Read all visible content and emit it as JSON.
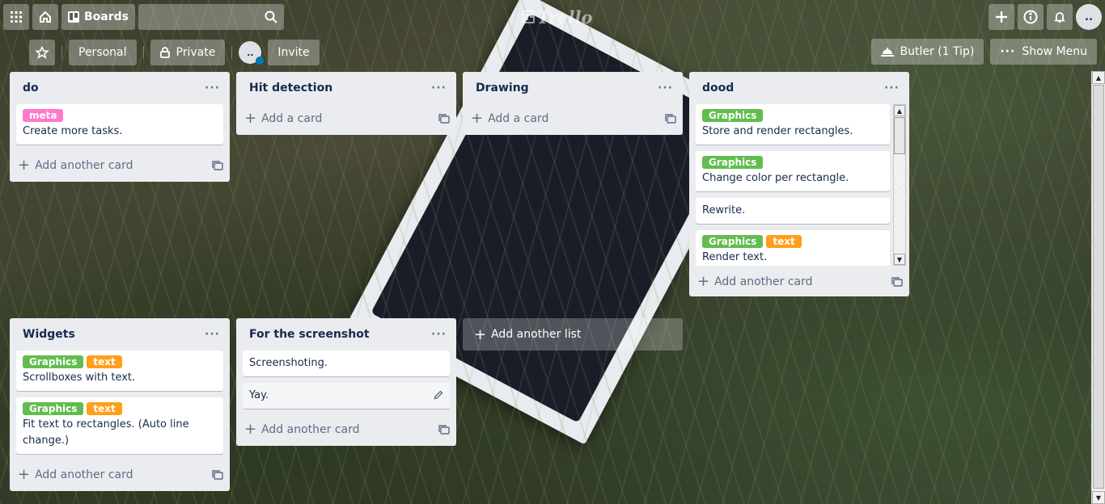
{
  "header": {
    "boards_label": "Boards",
    "logo_text": "Trello",
    "avatar_initials": "..",
    "search_placeholder": ""
  },
  "board": {
    "personal_label": "Personal",
    "private_label": "Private",
    "member_avatar": "..",
    "invite_label": "Invite",
    "butler_label": "Butler (1 Tip)",
    "show_menu_label": "Show Menu"
  },
  "colors": {
    "green_label": "#61bd4f",
    "orange_label": "#ff9f1a",
    "pink_label": "#ff78cb"
  },
  "lists": [
    {
      "title": "do",
      "cards": [
        {
          "labels": [
            {
              "text": "meta",
              "color": "#ff78cb"
            }
          ],
          "text": "Create more tasks."
        }
      ],
      "add_label": "Add another card"
    },
    {
      "title": "Hit detection",
      "cards": [],
      "add_label": "Add a card"
    },
    {
      "title": "Drawing",
      "cards": [],
      "add_label": "Add a card"
    },
    {
      "title": "dood",
      "cards": [
        {
          "labels": [
            {
              "text": "Graphics",
              "color": "#61bd4f"
            }
          ],
          "text": "Store and render rectangles."
        },
        {
          "labels": [
            {
              "text": "Graphics",
              "color": "#61bd4f"
            }
          ],
          "text": "Change color per rectangle."
        },
        {
          "labels": [],
          "text": "Rewrite."
        },
        {
          "labels": [
            {
              "text": "Graphics",
              "color": "#61bd4f"
            },
            {
              "text": "text",
              "color": "#ff9f1a"
            }
          ],
          "text": "Render text."
        }
      ],
      "add_label": "Add another card"
    },
    {
      "title": "Widgets",
      "cards": [
        {
          "labels": [
            {
              "text": "Graphics",
              "color": "#61bd4f"
            },
            {
              "text": "text",
              "color": "#ff9f1a"
            }
          ],
          "text": "Scrollboxes with text."
        },
        {
          "labels": [
            {
              "text": "Graphics",
              "color": "#61bd4f"
            },
            {
              "text": "text",
              "color": "#ff9f1a"
            }
          ],
          "text": "Fit text to rectangles. (Auto line change.)"
        }
      ],
      "add_label": "Add another card"
    },
    {
      "title": "For the screenshot",
      "cards": [
        {
          "labels": [],
          "text": "Screenshoting."
        },
        {
          "labels": [],
          "text": "Yay."
        }
      ],
      "add_label": "Add another card"
    }
  ],
  "add_list_label": "Add another list"
}
